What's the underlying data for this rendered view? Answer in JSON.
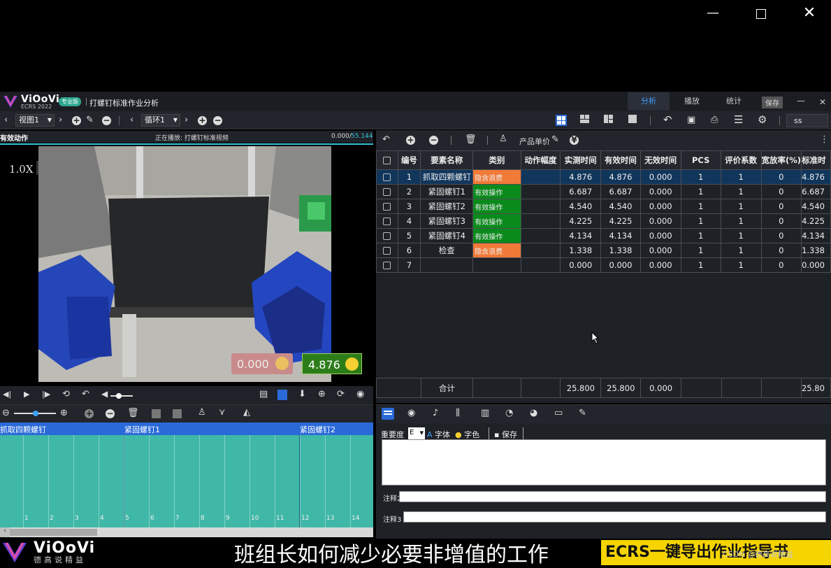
{
  "colors": {
    "accent": "#3ea0ff",
    "waste": "#f07a38",
    "valid": "#0b8a1c",
    "timeline": "#3fb8a8",
    "timeline_header": "#2a6ad8",
    "ecrs_banner": "#f5d400"
  },
  "app": {
    "brand": "ViOoVi",
    "brand_sub": "ECRS 2022",
    "badge": "专业版",
    "doc_title": "打螺钉标准作业分析",
    "tabs": [
      "分析",
      "播放",
      "统计"
    ],
    "save_label": "保存"
  },
  "toolbar": {
    "view_select": "视图1",
    "loop_select": "循环1",
    "search_value": "ss"
  },
  "video": {
    "header_left": "有效动作",
    "header_center": "正在播放: 打螺钉标准视频",
    "time_current": "0.000/",
    "time_total": "55.144",
    "zoom": "1.0X",
    "overlay_waste": "0.000",
    "overlay_valid": "4.876"
  },
  "timeline": {
    "segments": [
      {
        "label": "抓取四颗螺钉"
      },
      {
        "label": "紧固螺钉1"
      },
      {
        "label": "紧固螺钉2"
      }
    ],
    "ticks": [
      "1",
      "2",
      "3",
      "4",
      "5",
      "6",
      "7",
      "8",
      "9",
      "10",
      "11",
      "12",
      "13",
      "14"
    ]
  },
  "table_toolbar": {
    "unit_price_label": "产品单价"
  },
  "table": {
    "headers": [
      "编号",
      "要素名称",
      "类别",
      "动作幅度",
      "实测时间",
      "有效时间",
      "无效时间",
      "PCS",
      "评价系数",
      "宽放率(%)",
      "标准时"
    ],
    "rows": [
      {
        "no": "1",
        "name": "抓取四颗螺钉",
        "cat": "隐含浪费",
        "type": "waste",
        "measured": "4.876",
        "effective": "4.876",
        "invalid": "0.000",
        "pcs": "1",
        "coef": "1",
        "allow": "0",
        "std": "4.876"
      },
      {
        "no": "2",
        "name": "紧固螺钉1",
        "cat": "有效操作",
        "type": "valid",
        "measured": "6.687",
        "effective": "6.687",
        "invalid": "0.000",
        "pcs": "1",
        "coef": "1",
        "allow": "0",
        "std": "6.687"
      },
      {
        "no": "3",
        "name": "紧固螺钉2",
        "cat": "有效操作",
        "type": "valid",
        "measured": "4.540",
        "effective": "4.540",
        "invalid": "0.000",
        "pcs": "1",
        "coef": "1",
        "allow": "0",
        "std": "4.540"
      },
      {
        "no": "4",
        "name": "紧固螺钉3",
        "cat": "有效操作",
        "type": "valid",
        "measured": "4.225",
        "effective": "4.225",
        "invalid": "0.000",
        "pcs": "1",
        "coef": "1",
        "allow": "0",
        "std": "4.225"
      },
      {
        "no": "5",
        "name": "紧固螺钉4",
        "cat": "有效操作",
        "type": "valid",
        "measured": "4.134",
        "effective": "4.134",
        "invalid": "0.000",
        "pcs": "1",
        "coef": "1",
        "allow": "0",
        "std": "4.134"
      },
      {
        "no": "6",
        "name": "检查",
        "cat": "隐含浪费",
        "type": "waste",
        "measured": "1.338",
        "effective": "1.338",
        "invalid": "0.000",
        "pcs": "1",
        "coef": "1",
        "allow": "0",
        "std": "1.338"
      },
      {
        "no": "7",
        "name": "",
        "cat": "",
        "type": "",
        "measured": "0.000",
        "effective": "0.000",
        "invalid": "0.000",
        "pcs": "1",
        "coef": "1",
        "allow": "0",
        "std": "0.000"
      }
    ],
    "total": {
      "label": "合计",
      "measured": "25.800",
      "effective": "25.800",
      "invalid": "0.000",
      "std": "25.80"
    }
  },
  "notes": {
    "importance_label": "重要度",
    "importance_value": "E",
    "font_label": "字体",
    "color_label": "字色",
    "save_label": "保存",
    "note2_label": "注释2",
    "note3_label": "注释3"
  },
  "footer": {
    "brand": "ViOoVi",
    "brand_cn": "德高说精益",
    "subtitle": "班组长如何减少必要非增值的工作",
    "banner": "ECRS一键导出作业指导书",
    "watermark": "CSDN @德高说精益"
  }
}
